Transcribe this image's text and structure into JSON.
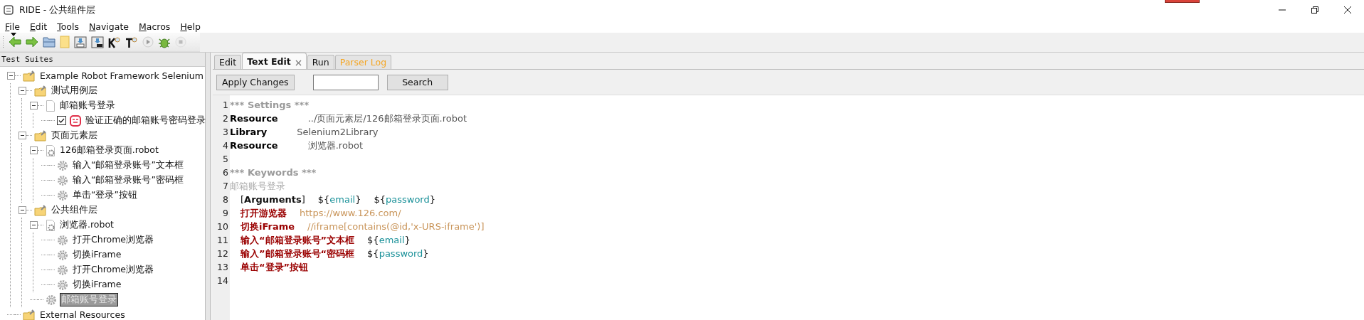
{
  "window": {
    "title": "RIDE - 公共组件层"
  },
  "menu": [
    "File",
    "Edit",
    "Tools",
    "Navigate",
    "Macros",
    "Help"
  ],
  "tree": {
    "header": "Test Suites",
    "nodes": [
      {
        "label": "Example Robot Framework Selenium",
        "kind": "suite",
        "expanded": true,
        "selected": false,
        "children": [
          {
            "label": "测试用例层",
            "kind": "suite",
            "expanded": true,
            "selected": false,
            "children": [
              {
                "label": "邮箱账号登录",
                "kind": "file",
                "expanded": true,
                "selected": false,
                "children": [
                  {
                    "label": "验证正确的邮箱账号密码登录",
                    "kind": "test",
                    "checked": true,
                    "selected": false
                  }
                ]
              }
            ]
          },
          {
            "label": "页面元素层",
            "kind": "suite",
            "expanded": true,
            "selected": false,
            "children": [
              {
                "label": "126邮箱登录页面.robot",
                "kind": "resource",
                "expanded": true,
                "selected": false,
                "children": [
                  {
                    "label": "输入“邮箱登录账号”文本框",
                    "kind": "keyword",
                    "selected": false
                  },
                  {
                    "label": "输入“邮箱登录账号”密码框",
                    "kind": "keyword",
                    "selected": false
                  },
                  {
                    "label": "单击“登录”按钮",
                    "kind": "keyword",
                    "selected": false
                  }
                ]
              }
            ]
          },
          {
            "label": "公共组件层",
            "kind": "suite",
            "expanded": true,
            "selected": false,
            "children": [
              {
                "label": "浏览器.robot",
                "kind": "resource",
                "expanded": true,
                "selected": false,
                "children": [
                  {
                    "label": "打开Chrome浏览器",
                    "kind": "keyword",
                    "selected": false
                  },
                  {
                    "label": "切换iFrame",
                    "kind": "keyword",
                    "selected": false
                  },
                  {
                    "label": "打开Chrome浏览器",
                    "kind": "keyword",
                    "selected": false
                  },
                  {
                    "label": "切换iFrame",
                    "kind": "keyword",
                    "selected": false
                  }
                ]
              },
              {
                "label": "邮箱账号登录",
                "kind": "keyword",
                "selected": true
              }
            ]
          }
        ]
      },
      {
        "label": "External Resources",
        "kind": "suite",
        "selected": false
      }
    ]
  },
  "tabs": [
    {
      "label": "Edit",
      "kind": "normal",
      "selected": false
    },
    {
      "label": "Text Edit",
      "kind": "normal",
      "selected": true
    },
    {
      "label": "Run",
      "kind": "normal",
      "selected": false
    },
    {
      "label": "Parser Log",
      "kind": "log",
      "selected": false
    }
  ],
  "editor_toolbar": {
    "apply_button": "Apply Changes",
    "search_button": "Search"
  },
  "editor": {
    "lines": [
      {
        "number": "1",
        "indented": false,
        "tokens": [
          {
            "kind": "section",
            "text": "*** Settings ***"
          }
        ]
      },
      {
        "number": "2",
        "indented": false,
        "tokens": [
          {
            "kind": "setting",
            "text": "Resource"
          },
          {
            "kind": "value",
            "text": "../页面元素层/126邮箱登录页面.robot"
          }
        ]
      },
      {
        "number": "3",
        "indented": false,
        "tokens": [
          {
            "kind": "setting",
            "text": "Library"
          },
          {
            "kind": "value",
            "text": "Selenium2Library"
          }
        ]
      },
      {
        "number": "4",
        "indented": false,
        "tokens": [
          {
            "kind": "setting",
            "text": "Resource"
          },
          {
            "kind": "value",
            "text": "浏览器.robot"
          }
        ]
      },
      {
        "number": "5"
      },
      {
        "number": "6",
        "indented": false,
        "tokens": [
          {
            "kind": "section",
            "text": "*** Keywords ***"
          }
        ]
      },
      {
        "number": "7",
        "indented": false,
        "tokens": [
          {
            "kind": "name",
            "text": "邮箱账号登录"
          }
        ]
      },
      {
        "number": "8",
        "indented": true,
        "tokens": [
          {
            "kind": "plain",
            "text": "[**Arguments**]"
          },
          {
            "kind": "variable",
            "parts": [
              "${",
              "email",
              "}"
            ]
          },
          {
            "kind": "variable",
            "parts": [
              "${",
              "password",
              "}"
            ]
          }
        ]
      },
      {
        "number": "9",
        "indented": true,
        "tokens": [
          {
            "kind": "keyword",
            "text": "打开游览器"
          },
          {
            "kind": "argument",
            "text": "https://www.126.com/"
          }
        ]
      },
      {
        "number": "10",
        "indented": true,
        "tokens": [
          {
            "kind": "keyword",
            "text": "切换iFrame"
          },
          {
            "kind": "argument",
            "text": "//iframe[contains(@id,'x-URS-iframe')]"
          }
        ]
      },
      {
        "number": "11",
        "indented": true,
        "tokens": [
          {
            "kind": "keyword",
            "text": "输入“邮箱登录账号”文本框"
          },
          {
            "kind": "variable",
            "parts": [
              "${",
              "email",
              "}"
            ]
          }
        ]
      },
      {
        "number": "12",
        "indented": true,
        "tokens": [
          {
            "kind": "keyword",
            "text": "输入”邮箱登录账号“密码框"
          },
          {
            "kind": "variable",
            "parts": [
              "${",
              "password",
              "}"
            ]
          }
        ]
      },
      {
        "number": "13",
        "indented": true,
        "tokens": [
          {
            "kind": "keyword",
            "text": "单击“登录”按钮"
          }
        ]
      },
      {
        "number": "14"
      }
    ]
  }
}
